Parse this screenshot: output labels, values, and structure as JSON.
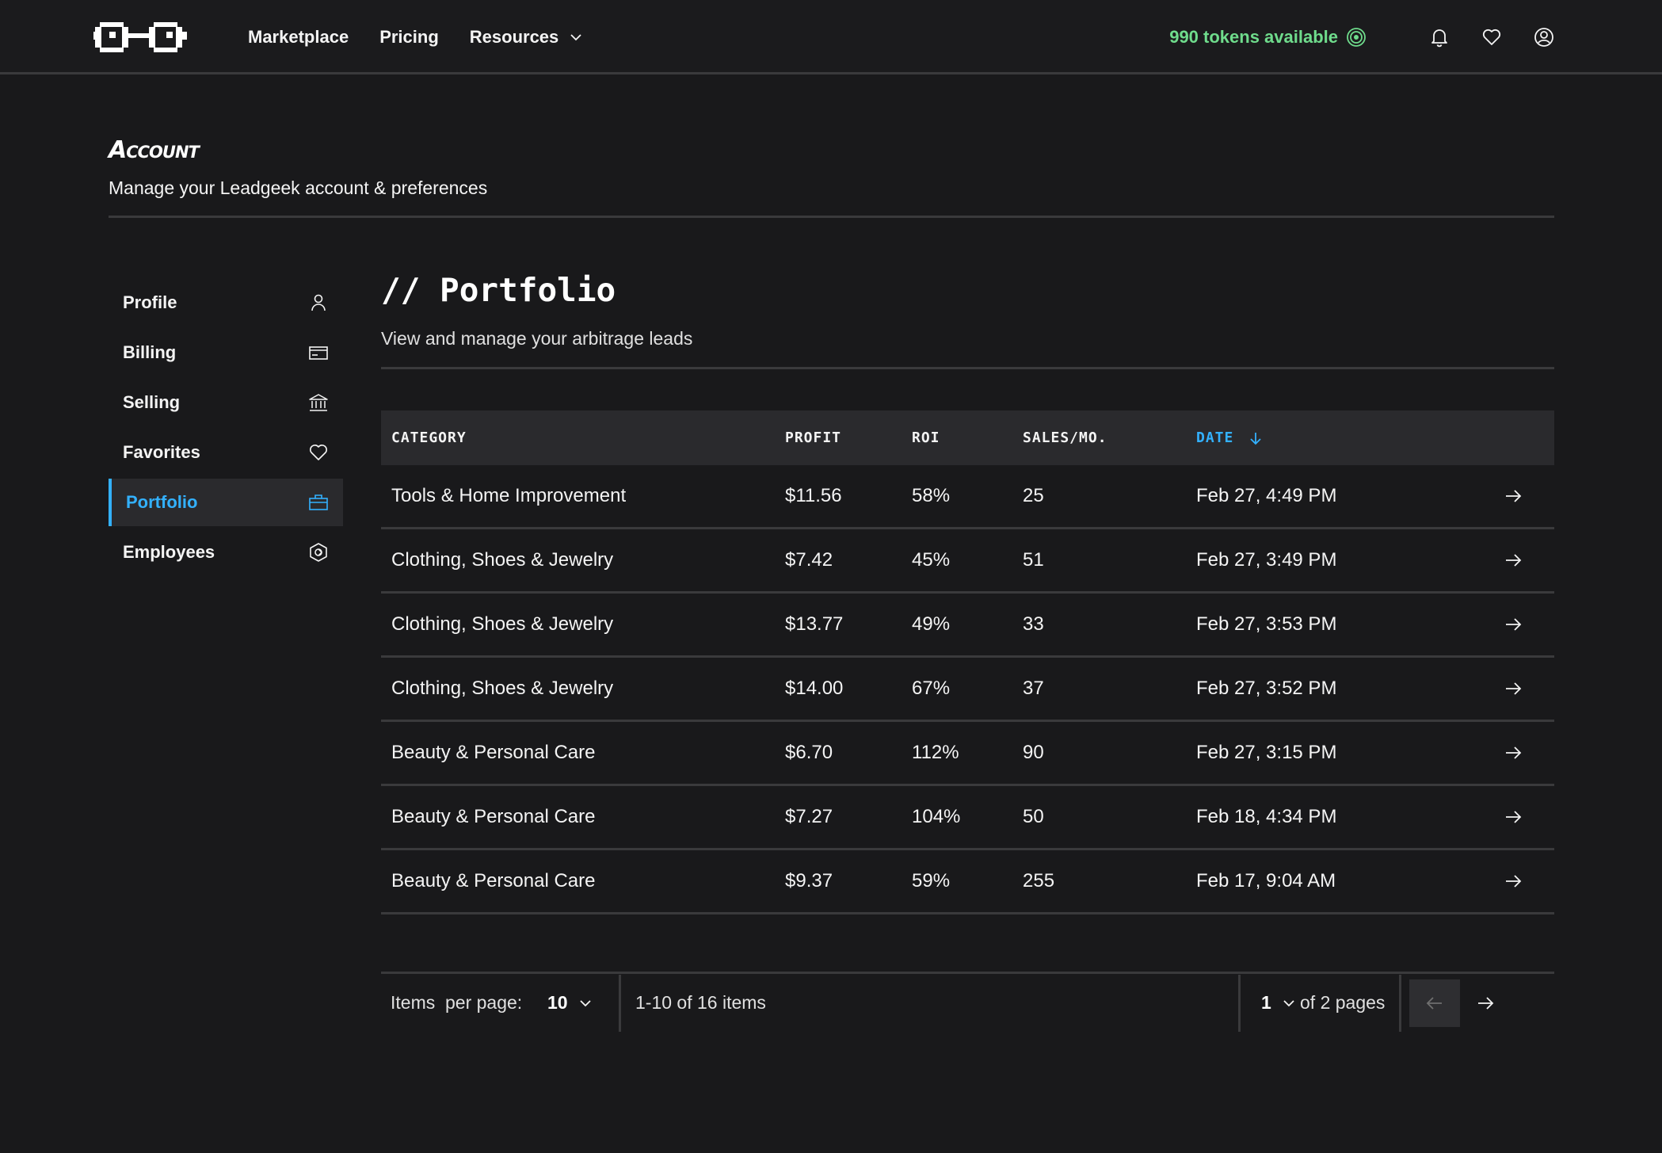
{
  "header": {
    "nav": [
      "Marketplace",
      "Pricing",
      "Resources"
    ],
    "tokens": "990 tokens available",
    "colors": {
      "accent": "#33b1ff",
      "tokens": "#6fdc8c",
      "background": "#19191b"
    }
  },
  "account": {
    "title": "Account",
    "subtitle": "Manage your Leadgeek account & preferences"
  },
  "sidebar": {
    "items": [
      {
        "label": "Profile",
        "icon": "user-icon"
      },
      {
        "label": "Billing",
        "icon": "credit-card-icon"
      },
      {
        "label": "Selling",
        "icon": "bank-icon"
      },
      {
        "label": "Favorites",
        "icon": "heart-icon"
      },
      {
        "label": "Portfolio",
        "icon": "briefcase-icon",
        "active": true
      },
      {
        "label": "Employees",
        "icon": "hexagon-badge-icon"
      }
    ]
  },
  "main": {
    "title": "// Portfolio",
    "subtitle": "View and manage your arbitrage leads"
  },
  "table": {
    "columns": [
      "CATEGORY",
      "PROFIT",
      "ROI",
      "SALES/MO.",
      "DATE"
    ],
    "sorted_column": "DATE",
    "sort_direction": "descending",
    "rows": [
      [
        "Tools & Home Improvement",
        "$11.56",
        "58%",
        "25",
        "Feb 27, 4:49 PM"
      ],
      [
        "Clothing, Shoes & Jewelry",
        "$7.42",
        "45%",
        "51",
        "Feb 27, 3:49 PM"
      ],
      [
        "Clothing, Shoes & Jewelry",
        "$13.77",
        "49%",
        "33",
        "Feb 27, 3:53 PM"
      ],
      [
        "Clothing, Shoes & Jewelry",
        "$14.00",
        "67%",
        "37",
        "Feb 27, 3:52 PM"
      ],
      [
        "Beauty & Personal Care",
        "$6.70",
        "112%",
        "90",
        "Feb 27, 3:15 PM"
      ],
      [
        "Beauty & Personal Care",
        "$7.27",
        "104%",
        "50",
        "Feb 18, 4:34 PM"
      ],
      [
        "Beauty & Personal Care",
        "$9.37",
        "59%",
        "255",
        "Feb 17, 9:04 AM"
      ]
    ]
  },
  "pagination": {
    "items_per_page_label": "Items  per page:",
    "items_per_page": "10",
    "range": "1-10 of 16 items",
    "current_page": "1",
    "of_pages": "of 2 pages"
  }
}
